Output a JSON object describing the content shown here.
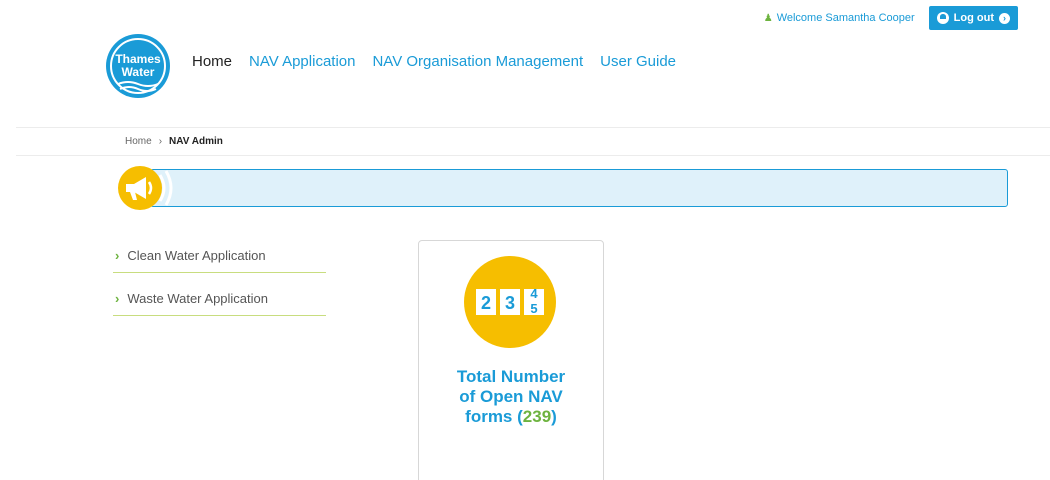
{
  "header": {
    "welcome_text": "Welcome Samantha Cooper",
    "logout_label": "Log out",
    "logo_text_line1": "Thames",
    "logo_text_line2": "Water"
  },
  "nav": {
    "items": [
      {
        "label": "Home",
        "active": true
      },
      {
        "label": "NAV Application",
        "active": false
      },
      {
        "label": "NAV Organisation Management",
        "active": false
      },
      {
        "label": "User Guide",
        "active": false
      }
    ]
  },
  "breadcrumb": {
    "home": "Home",
    "separator": "›",
    "current": "NAV Admin"
  },
  "sidebar": {
    "items": [
      {
        "label": "Clean Water Application"
      },
      {
        "label": "Waste Water Application"
      }
    ]
  },
  "card": {
    "counter_digits": [
      "2",
      "3",
      "4",
      "5"
    ],
    "title_prefix": "Total Number of Open NAV forms (",
    "count": "239",
    "title_suffix": ")"
  },
  "colors": {
    "brand_blue": "#1a9bd7",
    "accent_green": "#6db33f",
    "accent_yellow": "#f6be00",
    "notice_bg": "#dff1fa"
  }
}
